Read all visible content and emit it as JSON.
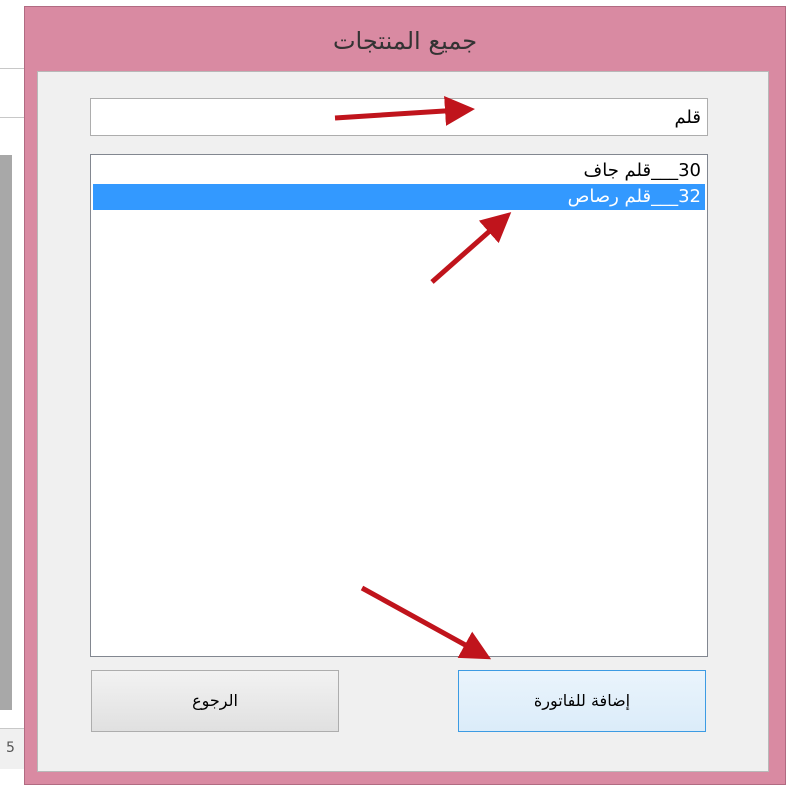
{
  "window": {
    "title": "جميع المنتجات"
  },
  "search": {
    "value": "قلم"
  },
  "products": [
    {
      "id": "30",
      "separator": "___",
      "name": "قلم جاف",
      "selected": false
    },
    {
      "id": "32",
      "separator": "___",
      "name": "قلم رصاص",
      "selected": true
    }
  ],
  "buttons": {
    "back_label": "الرجوع",
    "add_label": "إضافة للفاتورة"
  },
  "background": {
    "partial_text": "5"
  },
  "colors": {
    "frame": "#d98aa2",
    "selection": "#3399ff",
    "arrow": "#c0141c"
  }
}
